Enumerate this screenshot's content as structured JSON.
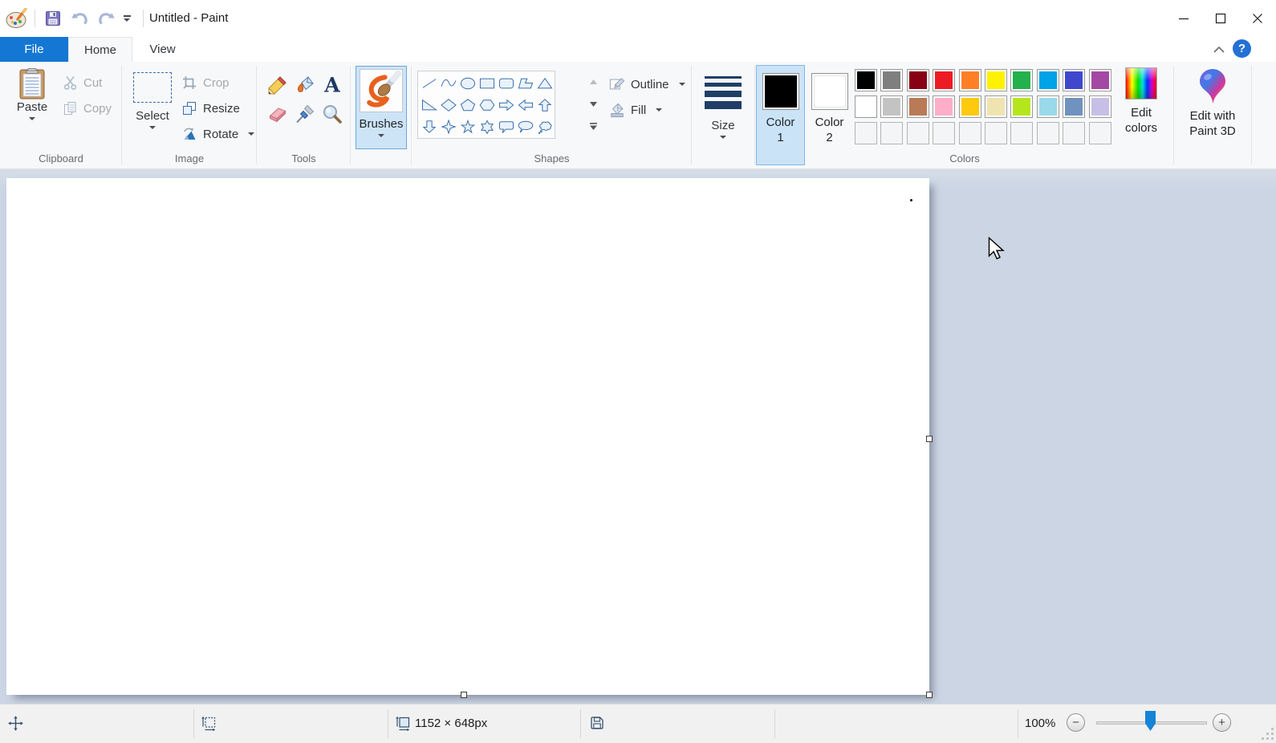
{
  "window": {
    "title": "Untitled - Paint",
    "controls": [
      "minimize",
      "maximize",
      "close"
    ]
  },
  "quick_access": {
    "icons": [
      "paint-logo",
      "save",
      "undo",
      "redo",
      "customize-quick-access"
    ]
  },
  "tabs": {
    "file": "File",
    "home": "Home",
    "view": "View"
  },
  "ribbon": {
    "clipboard": {
      "group_label": "Clipboard",
      "paste": "Paste",
      "cut": "Cut",
      "copy": "Copy"
    },
    "image": {
      "group_label": "Image",
      "select": "Select",
      "crop": "Crop",
      "resize": "Resize",
      "rotate": "Rotate"
    },
    "tools": {
      "group_label": "Tools",
      "items": [
        "pencil",
        "fill-with-color",
        "text",
        "eraser",
        "color-picker",
        "magnifier"
      ]
    },
    "brushes": {
      "label": "Brushes"
    },
    "shapes": {
      "group_label": "Shapes",
      "outline": "Outline",
      "fill": "Fill",
      "items": [
        "line",
        "curve",
        "ellipse",
        "rectangle",
        "rounded-rectangle",
        "polygon",
        "triangle",
        "right-triangle",
        "diamond",
        "pentagon",
        "hexagon",
        "right-arrow",
        "left-arrow",
        "up-arrow",
        "down-arrow",
        "four-point-star",
        "five-point-star",
        "six-point-star",
        "rounded-callout",
        "oval-callout",
        "cloud-callout"
      ]
    },
    "size": {
      "label": "Size"
    },
    "colors": {
      "group_label": "Colors",
      "color1": {
        "label": "Color 1",
        "value": "#000000"
      },
      "color2": {
        "label": "Color 2",
        "value": "#ffffff"
      },
      "palette": [
        [
          "#000000",
          "#7f7f7f",
          "#880015",
          "#ed1c24",
          "#ff7f27",
          "#fff200",
          "#22b14c",
          "#00a2e8",
          "#3f48cc",
          "#a349a4"
        ],
        [
          "#ffffff",
          "#c3c3c3",
          "#b97a57",
          "#ffaec9",
          "#ffc90e",
          "#efe4b0",
          "#b5e61d",
          "#99d9ea",
          "#7092be",
          "#c8bfe7"
        ],
        [
          null,
          null,
          null,
          null,
          null,
          null,
          null,
          null,
          null,
          null
        ]
      ],
      "edit_colors": "Edit colors"
    },
    "paint3d": {
      "label": "Edit with Paint 3D"
    }
  },
  "status_bar": {
    "canvas_size": "1152 × 648px",
    "zoom": "100%"
  },
  "accent_colors": {
    "file_tab": "#1377d3",
    "selection_highlight": "#cde4f7",
    "workarea": "#cbd5e4"
  }
}
